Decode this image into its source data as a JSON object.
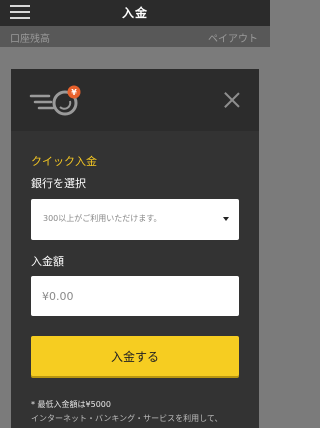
{
  "header": {
    "title": "入金",
    "menu_icon": "hamburger-icon"
  },
  "balance_bar": {
    "balance_label": "口座残高",
    "payout_label": "ペイアウト"
  },
  "modal": {
    "logo_icon": "fast-coin-icon",
    "logo_badge": "¥",
    "close_icon": "close-icon",
    "section_title": "クイック入金",
    "bank_label": "銀行を選択",
    "bank_select_text": "300以上がご利用いただけます。",
    "amount_label": "入金額",
    "amount_placeholder": "¥0.00",
    "deposit_button_label": "入金する",
    "min_deposit_text": "* 最低入金額は¥5000",
    "notice_text": "インターネット・バンキング・サービスを利用して、"
  },
  "colors": {
    "accent": "#f6cd21",
    "modal_bg": "#333333",
    "header_bg": "#2b2b2b",
    "overlay_bg": "#7b7b7b",
    "badge": "#e8612c"
  }
}
